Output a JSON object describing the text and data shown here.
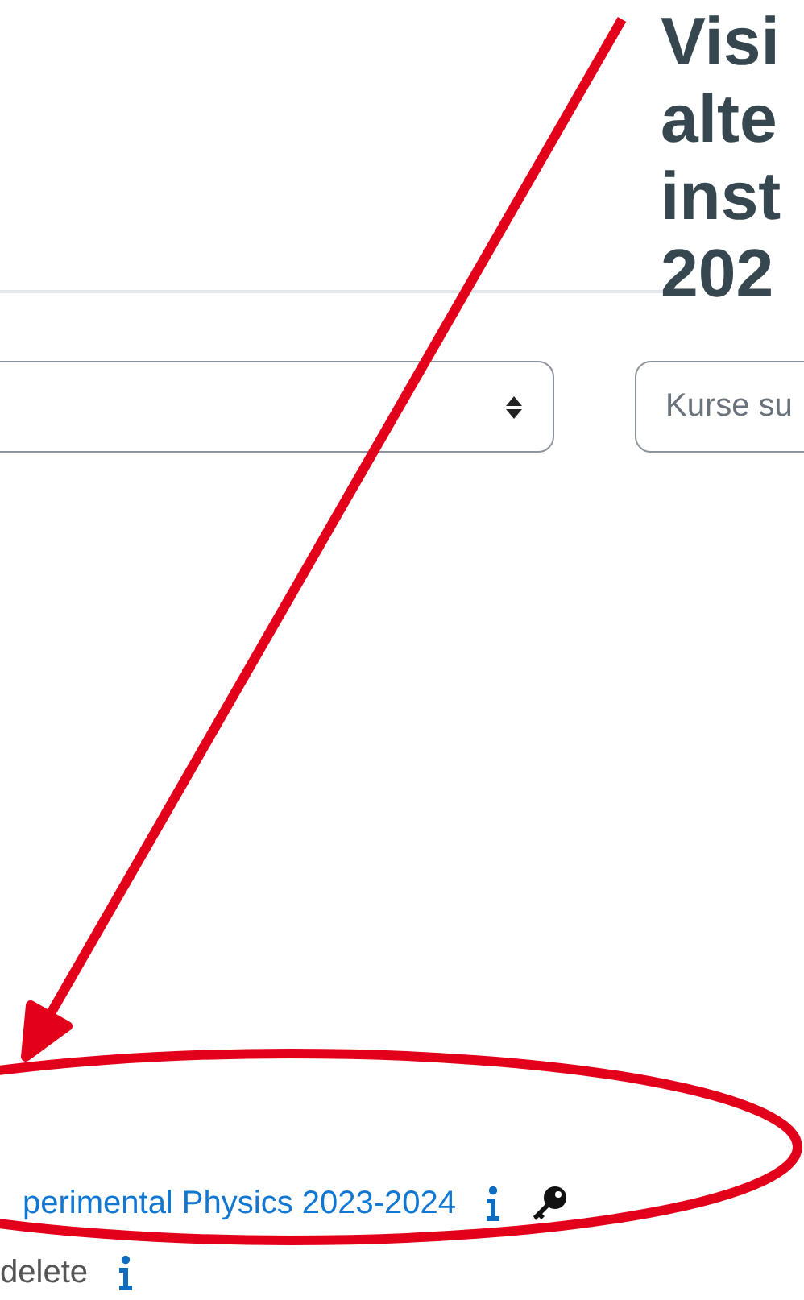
{
  "heading_lines": [
    "Visi",
    "alte",
    "inst",
    "202"
  ],
  "course_search": {
    "placeholder": "Kurse su"
  },
  "courses": [
    {
      "title": "perimental Physics 2023-2024",
      "kind": "link",
      "has_key": true
    },
    {
      "title": "delete",
      "kind": "muted",
      "has_key": false
    }
  ]
}
